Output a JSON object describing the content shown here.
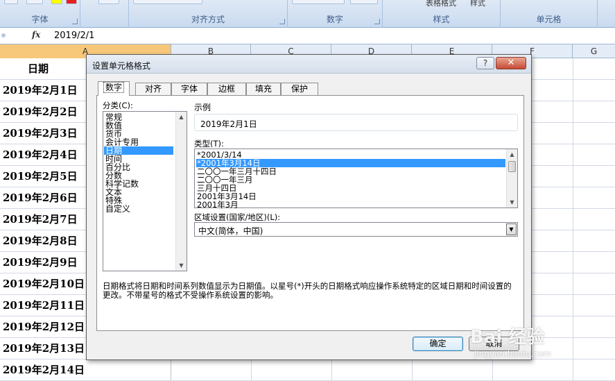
{
  "ribbon": {
    "groups": [
      "字体",
      "对齐方式",
      "数字",
      "样式",
      "单元格"
    ],
    "style_items": [
      "表格格式",
      "样式"
    ]
  },
  "formula_bar": {
    "fx": "fx",
    "value": "2019/2/1"
  },
  "columns": [
    "A",
    "B",
    "C",
    "D",
    "E",
    "F",
    "G"
  ],
  "sheet": {
    "header": "日期",
    "dates": [
      "2019年2月1日",
      "2019年2月2日",
      "2019年2月3日",
      "2019年2月4日",
      "2019年2月5日",
      "2019年2月6日",
      "2019年2月7日",
      "2019年2月8日",
      "2019年2月9日",
      "2019年2月10日",
      "2019年2月11日",
      "2019年2月12日",
      "2019年2月13日",
      "2019年2月14日"
    ]
  },
  "dialog": {
    "title": "设置单元格格式",
    "help": "?",
    "close": "✕",
    "tabs": [
      "数字",
      "对齐",
      "字体",
      "边框",
      "填充",
      "保护"
    ],
    "category_label": "分类(C):",
    "categories": [
      "常规",
      "数值",
      "货币",
      "会计专用",
      "日期",
      "时间",
      "百分比",
      "分数",
      "科学记数",
      "文本",
      "特殊",
      "自定义"
    ],
    "selected_category": "日期",
    "sample_label": "示例",
    "sample_value": "2019年2月1日",
    "type_label": "类型(T):",
    "types": [
      "*2001/3/14",
      "*2001年3月14日",
      "二〇〇一年三月十四日",
      "二〇〇一年三月",
      "三月十四日",
      "2001年3月14日",
      "2001年3月"
    ],
    "selected_type": "*2001年3月14日",
    "locale_label": "区域设置(国家/地区)(L):",
    "locale_value": "中文(简体，中国)",
    "description": "日期格式将日期和时间系列数值显示为日期值。以星号(*)开头的日期格式响应操作系统特定的区域日期和时间设置的更改。不带星号的格式不受操作系统设置的影响。",
    "ok_label": "确定",
    "cancel_label": "取消"
  },
  "watermark": {
    "main": "Bai 经验",
    "sub": "jingyan.baidu.com"
  }
}
